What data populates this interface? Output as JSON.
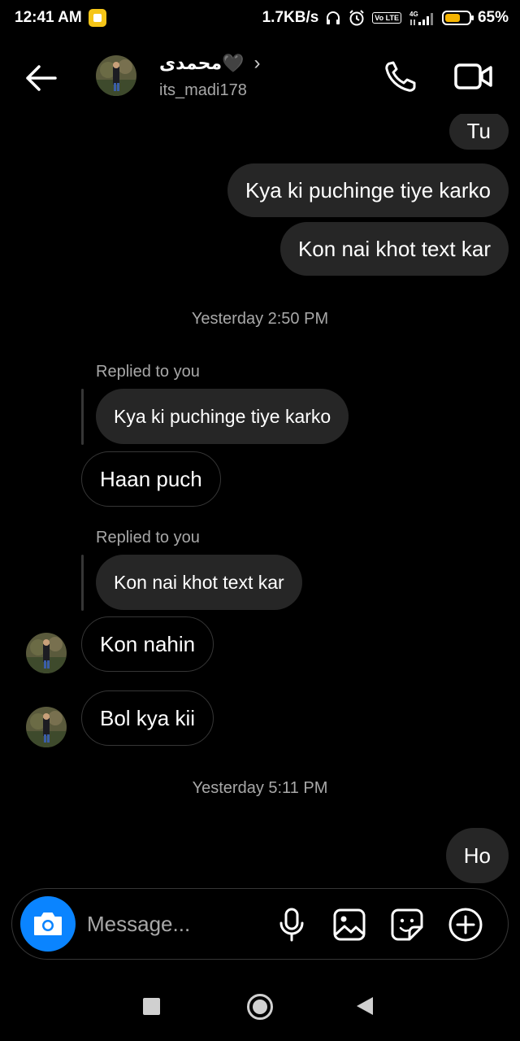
{
  "status_bar": {
    "time": "12:41 AM",
    "net_speed": "1.7KB/s",
    "battery_level": 0.65,
    "battery_text": "65%",
    "volte_label": "Vo LTE",
    "network_type": "4G"
  },
  "header": {
    "name": "محمدی🖤",
    "username": "its_madi178",
    "chevron": "›"
  },
  "messages": {
    "sent_tu": "Tu",
    "sent_kya": "Kya ki puchinge tiye karko",
    "sent_kon": "Kon nai khot text kar",
    "timestamp_1": "Yesterday 2:50 PM",
    "reply_1_label": "Replied to you",
    "reply_1_quote": "Kya ki puchinge tiye karko",
    "reply_1_text": "Haan puch",
    "reply_2_label": "Replied to you",
    "reply_2_quote": "Kon nai khot text kar",
    "recv_kon_nahin": "Kon nahin",
    "recv_bol": "Bol kya kii",
    "timestamp_2": "Yesterday 5:11 PM",
    "sent_ho": "Ho"
  },
  "composer": {
    "placeholder": "Message..."
  },
  "colors": {
    "background": "#000000",
    "sent_bubble": "#262626",
    "camera_button": "#0a84ff",
    "secondary_text": "#a8a8a8"
  },
  "icons": [
    "back-arrow-icon",
    "call-icon",
    "video-call-icon",
    "camera-icon",
    "microphone-icon",
    "gallery-icon",
    "sticker-icon",
    "plus-icon"
  ]
}
